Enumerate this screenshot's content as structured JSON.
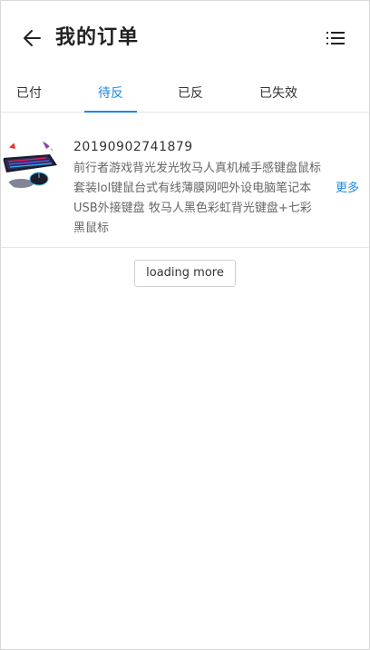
{
  "header": {
    "title": "我的订单",
    "back_icon": "arrow-left-icon",
    "menu_icon": "list-icon"
  },
  "tabs": [
    {
      "label": "已付",
      "active": false
    },
    {
      "label": "待反",
      "active": true
    },
    {
      "label": "已反",
      "active": false
    },
    {
      "label": "已失效",
      "active": false
    }
  ],
  "orders": [
    {
      "order_no": "20190902741879",
      "description": "前行者游戏背光发光牧马人真机械手感键盘鼠标套装lol键鼠台式有线薄膜网吧外设电脑笔记本USB外接键盘 牧马人黑色彩虹背光键盘+七彩黑鼠标",
      "more_label": "更多",
      "thumbnail": "keyboard-mouse-image"
    }
  ],
  "loading_more_label": "loading more",
  "colors": {
    "accent": "#1e88e5",
    "text": "#333333",
    "muted": "#666666",
    "divider": "#e6e6e6"
  }
}
